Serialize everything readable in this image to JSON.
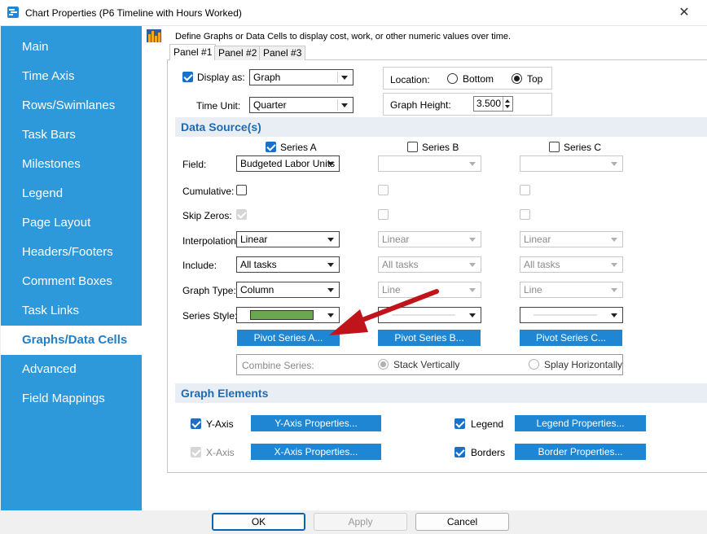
{
  "window": {
    "title": "Chart Properties (P6 Timeline with Hours Worked)",
    "close_glyph": "✕"
  },
  "sidebar": {
    "items": [
      {
        "label": "Main"
      },
      {
        "label": "Time Axis"
      },
      {
        "label": "Rows/Swimlanes"
      },
      {
        "label": "Task Bars"
      },
      {
        "label": "Milestones"
      },
      {
        "label": "Legend"
      },
      {
        "label": "Page Layout"
      },
      {
        "label": "Headers/Footers"
      },
      {
        "label": "Comment Boxes"
      },
      {
        "label": "Task Links"
      },
      {
        "label": "Graphs/Data Cells"
      },
      {
        "label": "Advanced"
      },
      {
        "label": "Field Mappings"
      }
    ],
    "active_index": 10,
    "color": "#2d98da"
  },
  "main": {
    "description": "Define Graphs or Data Cells to display cost, work, or other numeric values over time.",
    "tabs": [
      {
        "label": "Panel #1"
      },
      {
        "label": "Panel #2"
      },
      {
        "label": "Panel #3"
      }
    ],
    "display_as": {
      "label": "Display as:",
      "value": "Graph",
      "checked": true
    },
    "time_unit": {
      "label": "Time Unit:",
      "value": "Quarter"
    },
    "location": {
      "label": "Location:",
      "bottom": "Bottom",
      "top": "Top",
      "selected": "Top"
    },
    "graph_height": {
      "label": "Graph Height:",
      "value": "3.500"
    },
    "data_source": {
      "header": "Data Source(s)",
      "series": [
        {
          "name": "Series A",
          "checked": true,
          "field": "Budgeted Labor Units",
          "interpolation": "Linear",
          "include": "All tasks",
          "graph_type": "Column",
          "pivot": "Pivot Series A...",
          "style_color": "#6aa84f"
        },
        {
          "name": "Series B",
          "checked": false,
          "field": "",
          "interpolation": "Linear",
          "include": "All tasks",
          "graph_type": "Line",
          "pivot": "Pivot Series B..."
        },
        {
          "name": "Series C",
          "checked": false,
          "field": "",
          "interpolation": "Linear",
          "include": "All tasks",
          "graph_type": "Line",
          "pivot": "Pivot Series C..."
        }
      ],
      "row_labels": {
        "field": "Field:",
        "cumulative": "Cumulative:",
        "skip_zeros": "Skip Zeros:",
        "interpolation": "Interpolation:",
        "include": "Include:",
        "graph_type": "Graph Type:",
        "series_style": "Series Style:"
      },
      "combine": {
        "label": "Combine Series:",
        "stack": "Stack Vertically",
        "splay": "Splay Horizontally",
        "selected": "Stack Vertically"
      }
    },
    "graph_elements": {
      "header": "Graph Elements",
      "y_axis": {
        "label": "Y-Axis",
        "checked": true,
        "button": "Y-Axis Properties..."
      },
      "x_axis": {
        "label": "X-Axis",
        "checked": true,
        "button": "X-Axis Properties..."
      },
      "legend": {
        "label": "Legend",
        "checked": true,
        "button": "Legend Properties..."
      },
      "borders": {
        "label": "Borders",
        "checked": true,
        "button": "Border Properties..."
      }
    }
  },
  "footer": {
    "ok": "OK",
    "apply": "Apply",
    "cancel": "Cancel"
  },
  "annotation": {
    "arrow_color": "#c0141a"
  }
}
